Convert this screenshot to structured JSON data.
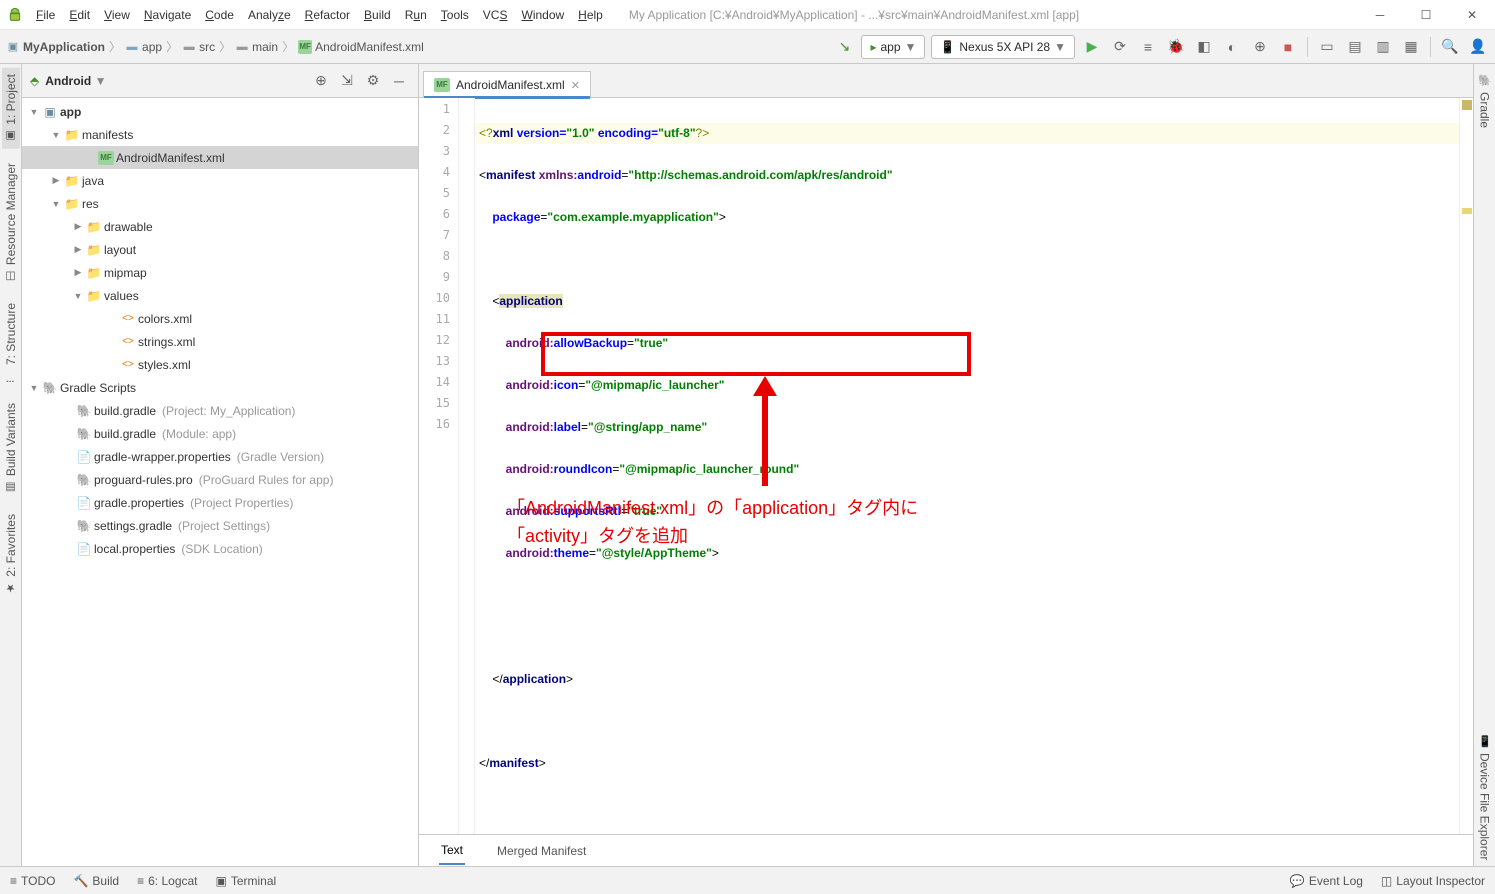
{
  "title": "My Application [C:¥Android¥MyApplication] - ...¥src¥main¥AndroidManifest.xml [app]",
  "menu": [
    "File",
    "Edit",
    "View",
    "Navigate",
    "Code",
    "Analyze",
    "Refactor",
    "Build",
    "Run",
    "Tools",
    "VCS",
    "Window",
    "Help"
  ],
  "breadcrumb": [
    "MyApplication",
    "app",
    "src",
    "main",
    "AndroidManifest.xml"
  ],
  "run_config": "app",
  "device": "Nexus 5X API 28",
  "project_header": "Android",
  "tree": {
    "app": "app",
    "manifests": "manifests",
    "manifest_file": "AndroidManifest.xml",
    "java": "java",
    "res": "res",
    "drawable": "drawable",
    "layout": "layout",
    "mipmap": "mipmap",
    "values": "values",
    "colors": "colors.xml",
    "strings": "strings.xml",
    "styles": "styles.xml",
    "gradle_scripts": "Gradle Scripts",
    "build_gradle1": "build.gradle",
    "build_gradle1_hint": "(Project: My_Application)",
    "build_gradle2": "build.gradle",
    "build_gradle2_hint": "(Module: app)",
    "wrapper": "gradle-wrapper.properties",
    "wrapper_hint": "(Gradle Version)",
    "proguard": "proguard-rules.pro",
    "proguard_hint": "(ProGuard Rules for app)",
    "gradle_props": "gradle.properties",
    "gradle_props_hint": "(Project Properties)",
    "settings": "settings.gradle",
    "settings_hint": "(Project Settings)",
    "local": "local.properties",
    "local_hint": "(SDK Location)"
  },
  "editor_tab": "AndroidManifest.xml",
  "code_lines": {
    "1": "<?xml version=\"1.0\" encoding=\"utf-8\"?>",
    "2": "<manifest xmlns:android=\"http://schemas.android.com/apk/res/android\"",
    "3": "    package=\"com.example.myapplication\">",
    "4": "",
    "5": "    <application",
    "6": "        android:allowBackup=\"true\"",
    "7": "        android:icon=\"@mipmap/ic_launcher\"",
    "8": "        android:label=\"@string/app_name\"",
    "9": "        android:roundIcon=\"@mipmap/ic_launcher_round\"",
    "10": "        android:supportsRtl=\"true\"",
    "11": "        android:theme=\"@style/AppTheme\">",
    "12": "",
    "13": "",
    "14": "    </application>",
    "15": "",
    "16": "</manifest>"
  },
  "annotation": "「AndroidManifest.xml」の「application」タグ内に\n「activity」タグを追加",
  "bottom_tabs": {
    "text": "Text",
    "merged": "Merged Manifest"
  },
  "left_tabs": {
    "project": "1: Project",
    "resman": "Resource Manager",
    "structure": "7: Structure",
    "variants": "Build Variants",
    "favorites": "2: Favorites"
  },
  "right_tabs": {
    "gradle": "Gradle",
    "explorer": "Device File Explorer"
  },
  "status": {
    "todo": "TODO",
    "build": "Build",
    "logcat": "6: Logcat",
    "terminal": "Terminal",
    "event": "Event Log",
    "layout": "Layout Inspector"
  }
}
